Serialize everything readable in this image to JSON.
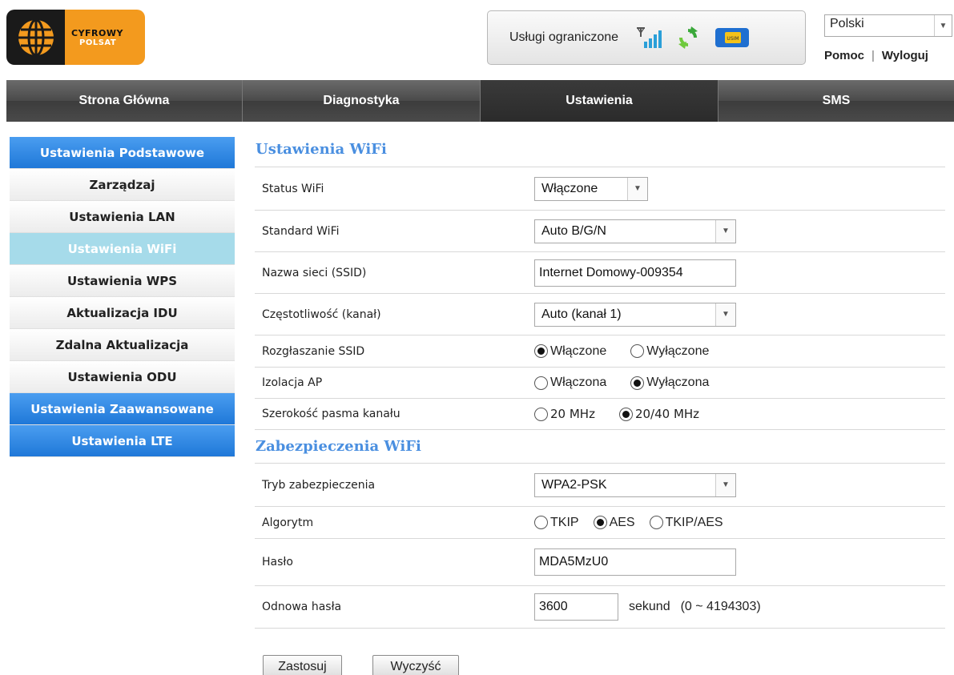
{
  "header": {
    "logo": {
      "line1": "CYFROWY",
      "line2": "POLSAT"
    },
    "status": {
      "text": "Usługi ograniczone",
      "icons": [
        "signal-icon",
        "sync-icon",
        "usim-icon"
      ],
      "usim_label": "USIM"
    },
    "language": {
      "selected": "Polski"
    },
    "links": {
      "help": "Pomoc",
      "separator": "|",
      "logout": "Wyloguj"
    }
  },
  "nav": {
    "tabs": [
      {
        "label": "Strona Główna",
        "active": false
      },
      {
        "label": "Diagnostyka",
        "active": false
      },
      {
        "label": "Ustawienia",
        "active": true
      },
      {
        "label": "SMS",
        "active": false
      }
    ]
  },
  "sidebar": {
    "items": [
      {
        "label": "Ustawienia Podstawowe",
        "style": "header"
      },
      {
        "label": "Zarządzaj",
        "style": "normal"
      },
      {
        "label": "Ustawienia LAN",
        "style": "normal"
      },
      {
        "label": "Ustawienia WiFi",
        "style": "selected"
      },
      {
        "label": "Ustawienia WPS",
        "style": "normal"
      },
      {
        "label": "Aktualizacja IDU",
        "style": "normal"
      },
      {
        "label": "Zdalna Aktualizacja",
        "style": "normal"
      },
      {
        "label": "Ustawienia ODU",
        "style": "normal"
      },
      {
        "label": "Ustawienia Zaawansowane",
        "style": "header"
      },
      {
        "label": "Ustawienia LTE",
        "style": "header"
      }
    ]
  },
  "wifi": {
    "title": "Ustawienia WiFi",
    "status_label": "Status WiFi",
    "status_value": "Włączone",
    "standard_label": "Standard WiFi",
    "standard_value": "Auto B/G/N",
    "ssid_label": "Nazwa sieci (SSID)",
    "ssid_value": "Internet Domowy-009354",
    "channel_label": "Częstotliwość (kanał)",
    "channel_value": "Auto (kanał 1)",
    "broadcast_label": "Rozgłaszanie SSID",
    "broadcast_on": "Włączone",
    "broadcast_off": "Wyłączone",
    "isolation_label": "Izolacja AP",
    "isolation_on": "Włączona",
    "isolation_off": "Wyłączona",
    "bandwidth_label": "Szerokość pasma kanału",
    "bandwidth_20": "20 MHz",
    "bandwidth_40": "20/40 MHz"
  },
  "security": {
    "title": "Zabezpieczenia WiFi",
    "mode_label": "Tryb zabezpieczenia",
    "mode_value": "WPA2-PSK",
    "algorithm_label": "Algorytm",
    "algorithm_tkip": "TKIP",
    "algorithm_aes": "AES",
    "algorithm_both": "TKIP/AES",
    "password_label": "Hasło",
    "password_value": "MDA5MzU0",
    "renewal_label": "Odnowa hasła",
    "renewal_value": "3600",
    "renewal_unit": "sekund",
    "renewal_range": "(0 ~ 4194303)"
  },
  "actions": {
    "apply": "Zastosuj",
    "clear": "Wyczyść"
  },
  "colors": {
    "accent_blue": "#4a8fe0",
    "sidebar_blue": "#1f78d8",
    "selected": "#a6dbea",
    "logo_orange": "#f39a1e",
    "nav_dark": "#4a4a4a"
  }
}
